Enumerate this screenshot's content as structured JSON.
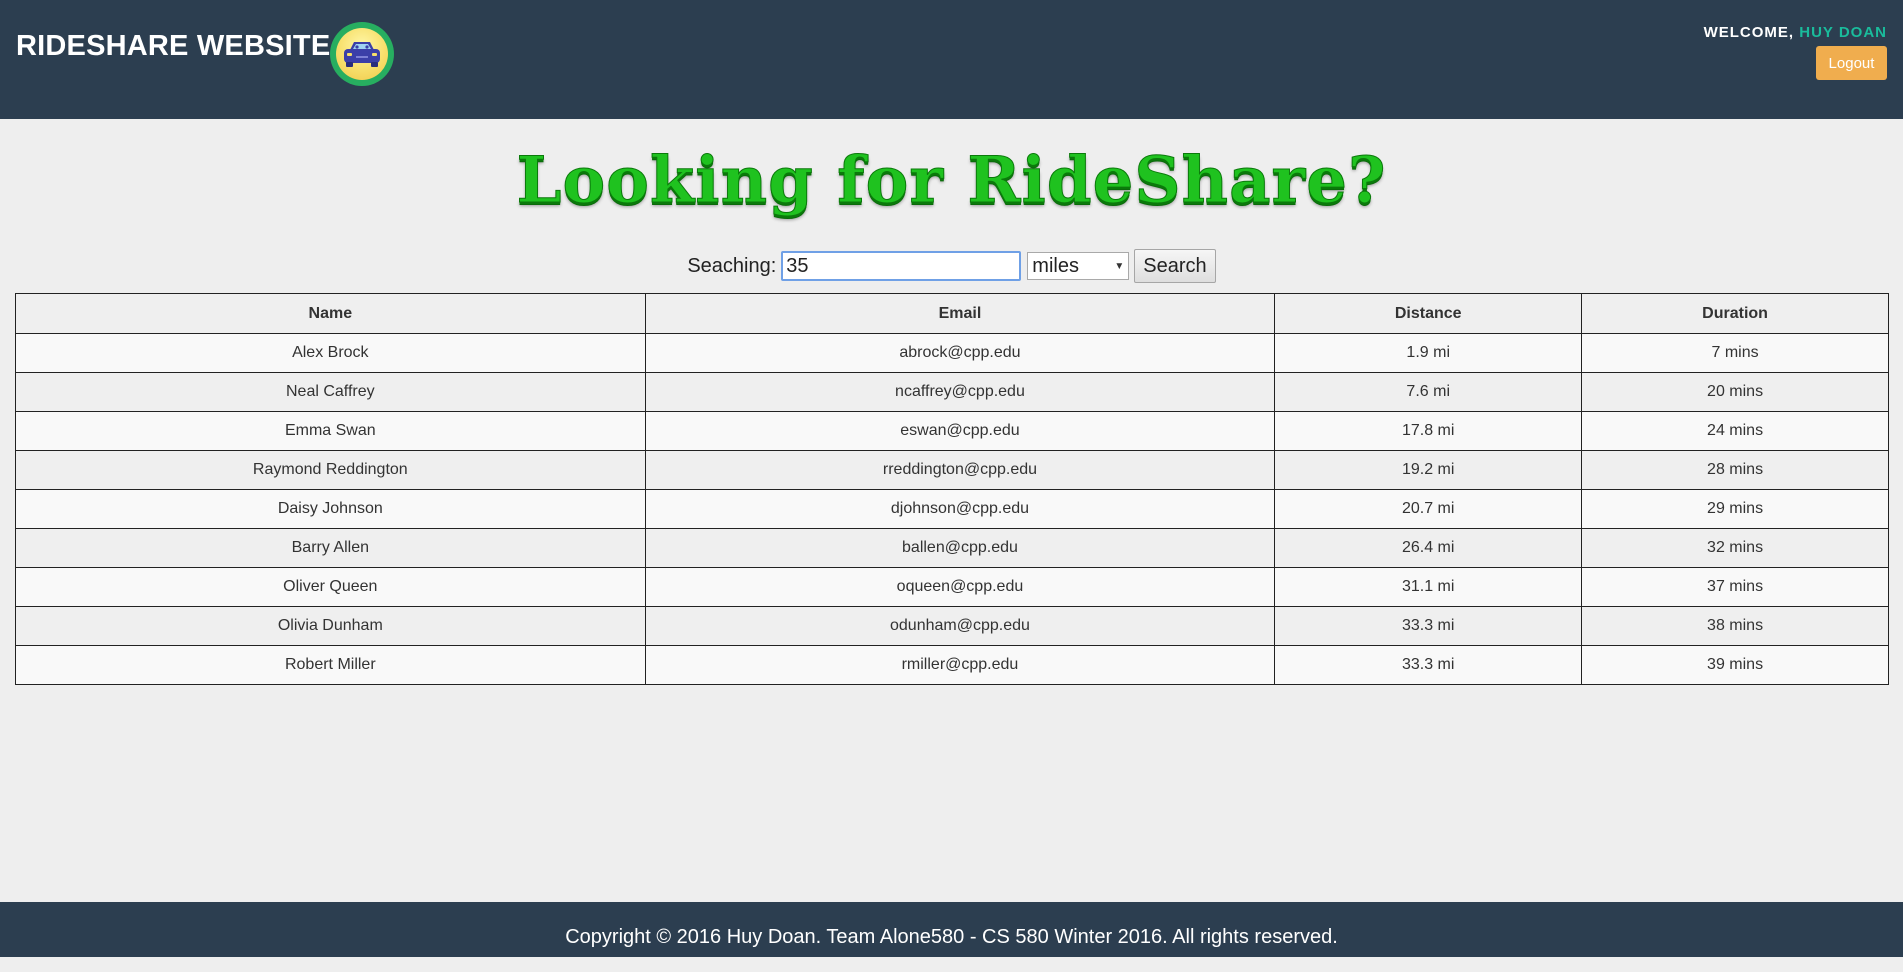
{
  "header": {
    "site_title": "RIDESHARE WEBSITE",
    "logo_icon": "car-icon",
    "welcome_label": "WELCOME,",
    "user_name": "HUY DOAN",
    "logout_label": "Logout"
  },
  "main": {
    "hero_title": "Looking for RideShare?",
    "search": {
      "label": "Seaching:",
      "value": "35",
      "unit_selected": "miles",
      "button_label": "Search"
    },
    "table": {
      "headers": [
        "Name",
        "Email",
        "Distance",
        "Duration"
      ],
      "rows": [
        [
          "Alex Brock",
          "abrock@cpp.edu",
          "1.9 mi",
          "7 mins"
        ],
        [
          "Neal Caffrey",
          "ncaffrey@cpp.edu",
          "7.6 mi",
          "20 mins"
        ],
        [
          "Emma Swan",
          "eswan@cpp.edu",
          "17.8 mi",
          "24 mins"
        ],
        [
          "Raymond Reddington",
          "rreddington@cpp.edu",
          "19.2 mi",
          "28 mins"
        ],
        [
          "Daisy Johnson",
          "djohnson@cpp.edu",
          "20.7 mi",
          "29 mins"
        ],
        [
          "Barry Allen",
          "ballen@cpp.edu",
          "26.4 mi",
          "32 mins"
        ],
        [
          "Oliver Queen",
          "oqueen@cpp.edu",
          "31.1 mi",
          "37 mins"
        ],
        [
          "Olivia Dunham",
          "odunham@cpp.edu",
          "33.3 mi",
          "38 mins"
        ],
        [
          "Robert Miller",
          "rmiller@cpp.edu",
          "33.3 mi",
          "39 mins"
        ]
      ]
    }
  },
  "footer": {
    "copyright": "Copyright © 2016 Huy Doan. Team Alone580 - CS 580 Winter 2016. All rights reserved."
  },
  "colors": {
    "header_bg": "#2c3e50",
    "accent_user": "#1abc9c",
    "logout_bg": "#f0ad4e",
    "hero_green": "#1fc21f",
    "page_bg": "#eeeeee"
  }
}
